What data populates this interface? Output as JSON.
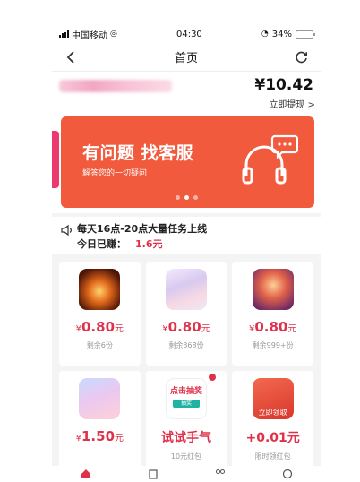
{
  "status_bar": {
    "carrier": "中国移动",
    "time": "04:30",
    "battery": "34%",
    "battery_level": 0.34
  },
  "nav": {
    "title": "首页",
    "back_icon": "chevron-left-icon",
    "refresh_icon": "refresh-icon"
  },
  "balance": {
    "amount": "¥10.42",
    "withdraw_label": "立即提现 >"
  },
  "banner": {
    "title": "有问题 找客服",
    "subtitle": "解答您的一切疑问",
    "icon": "headset-icon",
    "color": "#f15a3c",
    "active_dot": 1
  },
  "announcement": {
    "line1": "每天16点-20点大量任务上线",
    "earned_label": "今日已赚：",
    "earned_amount": "1.6元"
  },
  "tasks": [
    {
      "currency": "¥",
      "price": "0.80",
      "unit": "元",
      "remaining": "剩余6份"
    },
    {
      "currency": "¥",
      "price": "0.80",
      "unit": "元",
      "remaining": "剩余368份"
    },
    {
      "currency": "¥",
      "price": "0.80",
      "unit": "元",
      "remaining": "剩余999+份"
    },
    {
      "currency": "¥",
      "price": "1.50",
      "unit": "元",
      "remaining": ""
    },
    {
      "title": "试试手气",
      "subtitle": "10元红包",
      "lottery_text": "点击抽奖",
      "lottery_btn": "抽奖"
    },
    {
      "title": "+0.01元",
      "subtitle": "限时领红包",
      "card_tag": "立即领取"
    }
  ],
  "accent_color": "#e0314b"
}
